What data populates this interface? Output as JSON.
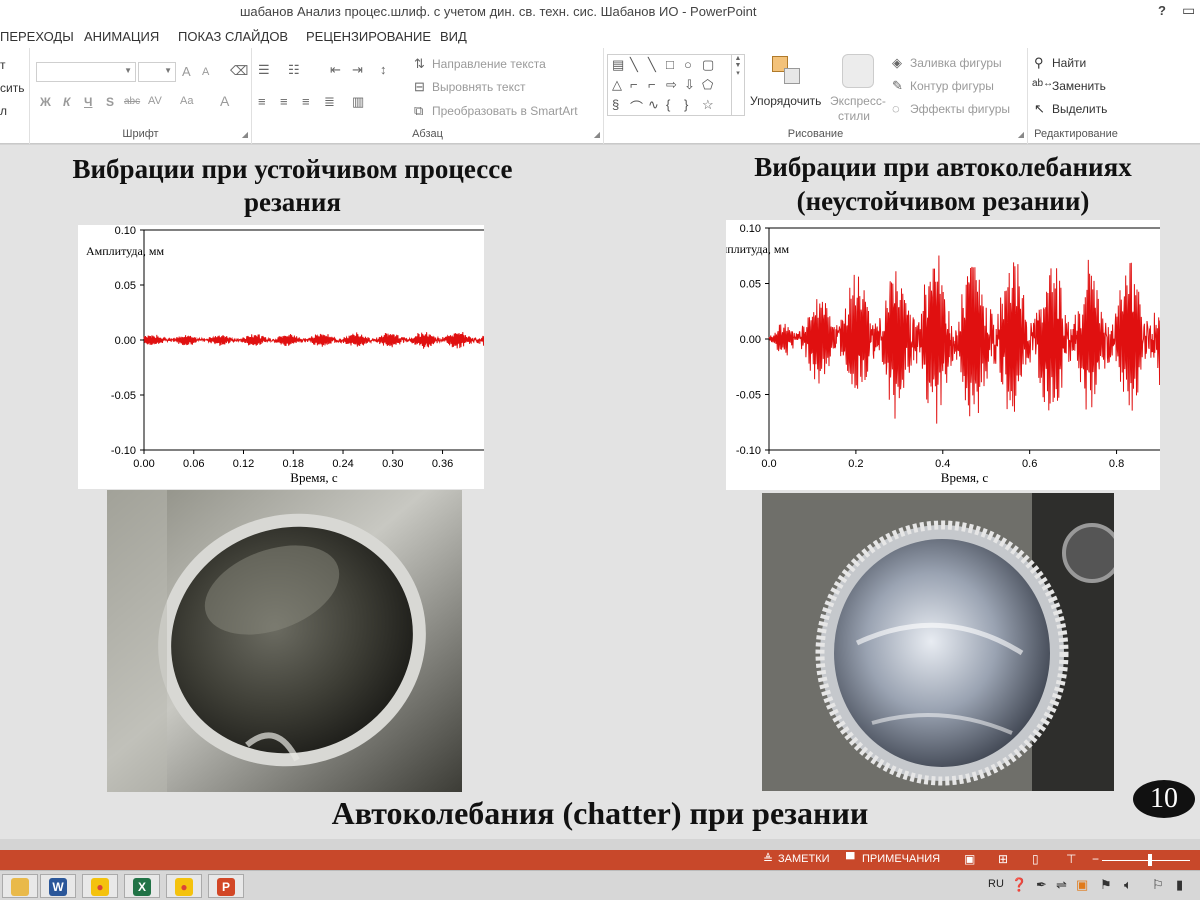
{
  "window": {
    "title": "шабанов Анализ процес.шлиф. с учетом дин. св. техн. сис. Шабанов ИО - PowerPoint",
    "help": "?"
  },
  "tabs": [
    "ПЕРЕХОДЫ",
    "АНИМАЦИЯ",
    "ПОКАЗ СЛАЙДОВ",
    "РЕЦЕНЗИРОВАНИЕ",
    "ВИД"
  ],
  "ribbon": {
    "clipboard_partial": [
      "т",
      "сить",
      "л"
    ],
    "font": {
      "label": "Шрифт",
      "bold": "Ж",
      "italic": "К",
      "underline": "Ч",
      "shadow": "S",
      "strike": "abc",
      "spacing": "AV",
      "case": "Aa",
      "color": "A",
      "grow": "A",
      "shrink": "A"
    },
    "paragraph": {
      "label": "Абзац",
      "text_direction": "Направление текста",
      "align_text": "Выровнять текст",
      "smartart": "Преобразовать в SmartArt"
    },
    "drawing": {
      "label": "Рисование",
      "arrange": "Упорядочить",
      "quick_styles_1": "Экспресс-",
      "quick_styles_2": "стили",
      "fill": "Заливка фигуры",
      "outline": "Контур фигуры",
      "effects": "Эффекты фигуры"
    },
    "editing": {
      "label": "Редактирование",
      "find": "Найти",
      "replace": "Заменить",
      "select": "Выделить"
    }
  },
  "slide": {
    "heading_left_1": "Вибрации  при  устойчивом процессе",
    "heading_left_2": "резания",
    "heading_right_1": "Вибрации  при  автоколебаниях",
    "heading_right_2": "(неустойчивом   резании)",
    "footer_title": "Автоколебания  (chatter) при  резании",
    "page_number": "10"
  },
  "chart_data": [
    {
      "type": "line",
      "title": "",
      "xlabel": "Время, с",
      "ylabel": "Амплитуда, мм",
      "xlim": [
        0,
        0.41
      ],
      "ylim": [
        -0.1,
        0.1
      ],
      "x_ticks": [
        "0.00",
        "0.06",
        "0.12",
        "0.18",
        "0.24",
        "0.30",
        "0.36"
      ],
      "y_ticks": [
        "0.10",
        "0.05",
        "0.00",
        "-0.05",
        "-0.10"
      ],
      "series": [
        {
          "color": "#e01010",
          "amplitude_envelope": [
            [
              0,
              0.004
            ],
            [
              0.2,
              0.005
            ],
            [
              0.41,
              0.007
            ]
          ]
        }
      ],
      "grid": false
    },
    {
      "type": "line",
      "title": "",
      "xlabel": "Время, с",
      "ylabel": "Амплитуда, мм",
      "xlim": [
        0,
        0.9
      ],
      "ylim": [
        -0.1,
        0.1
      ],
      "x_ticks": [
        "0.0",
        "0.2",
        "0.4",
        "0.6",
        "0.8"
      ],
      "y_ticks": [
        "0.10",
        "0.05",
        "0.00",
        "-0.05",
        "-0.10"
      ],
      "series": [
        {
          "color": "#e01010",
          "amplitude_envelope": [
            [
              0,
              0.002
            ],
            [
              0.05,
              0.02
            ],
            [
              0.15,
              0.04
            ],
            [
              0.3,
              0.06
            ],
            [
              0.45,
              0.065
            ],
            [
              0.6,
              0.06
            ],
            [
              0.9,
              0.055
            ]
          ]
        }
      ],
      "grid": false
    }
  ],
  "status": {
    "notes": "ЗАМЕТКИ",
    "comments": "ПРИМЕЧАНИЯ",
    "zoom_level": 0.55
  },
  "taskbar": {
    "apps": [
      {
        "name": "Word",
        "glyph": "W",
        "color": "#2b579a"
      },
      {
        "name": "Chrome",
        "glyph": "●",
        "color": "#db4437"
      },
      {
        "name": "Excel",
        "glyph": "X",
        "color": "#217346"
      },
      {
        "name": "Chrome",
        "glyph": "●",
        "color": "#db4437"
      },
      {
        "name": "PowerPoint",
        "glyph": "P",
        "color": "#d24726"
      }
    ],
    "language": "RU"
  }
}
